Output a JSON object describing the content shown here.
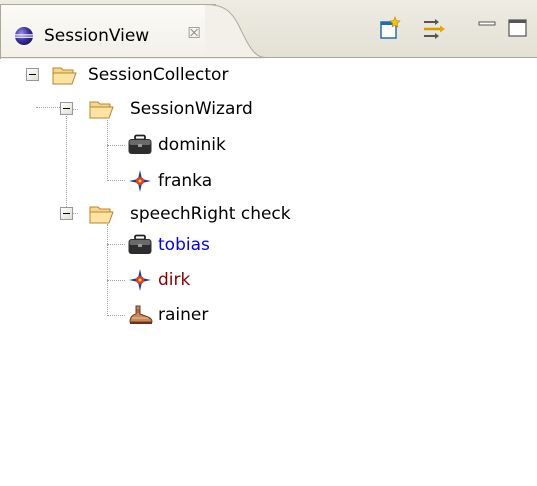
{
  "view": {
    "title": "SessionView",
    "close_glyph": "☒",
    "toolbar": [
      {
        "name": "new-session-icon"
      },
      {
        "name": "sync-icon"
      },
      {
        "name": "minimize-icon"
      },
      {
        "name": "maximize-icon"
      }
    ]
  },
  "tree": {
    "root": {
      "label": "SessionCollector",
      "icon": "folder-open-icon",
      "expanded": true
    },
    "folders": [
      {
        "label": "SessionWizard",
        "icon": "folder-open-icon",
        "expanded": true,
        "items": [
          {
            "label": "dominik",
            "icon": "briefcase-icon",
            "color": "#000000"
          },
          {
            "label": "franka",
            "icon": "compass-star-icon",
            "color": "#000000"
          }
        ]
      },
      {
        "label": "speechRight check",
        "icon": "folder-open-icon",
        "expanded": true,
        "items": [
          {
            "label": "tobias",
            "icon": "briefcase-icon",
            "color": "#0000ff"
          },
          {
            "label": "dirk",
            "icon": "compass-star-icon",
            "color": "#8b0000"
          },
          {
            "label": "rainer",
            "icon": "shoe-icon",
            "color": "#000000"
          }
        ]
      }
    ]
  }
}
